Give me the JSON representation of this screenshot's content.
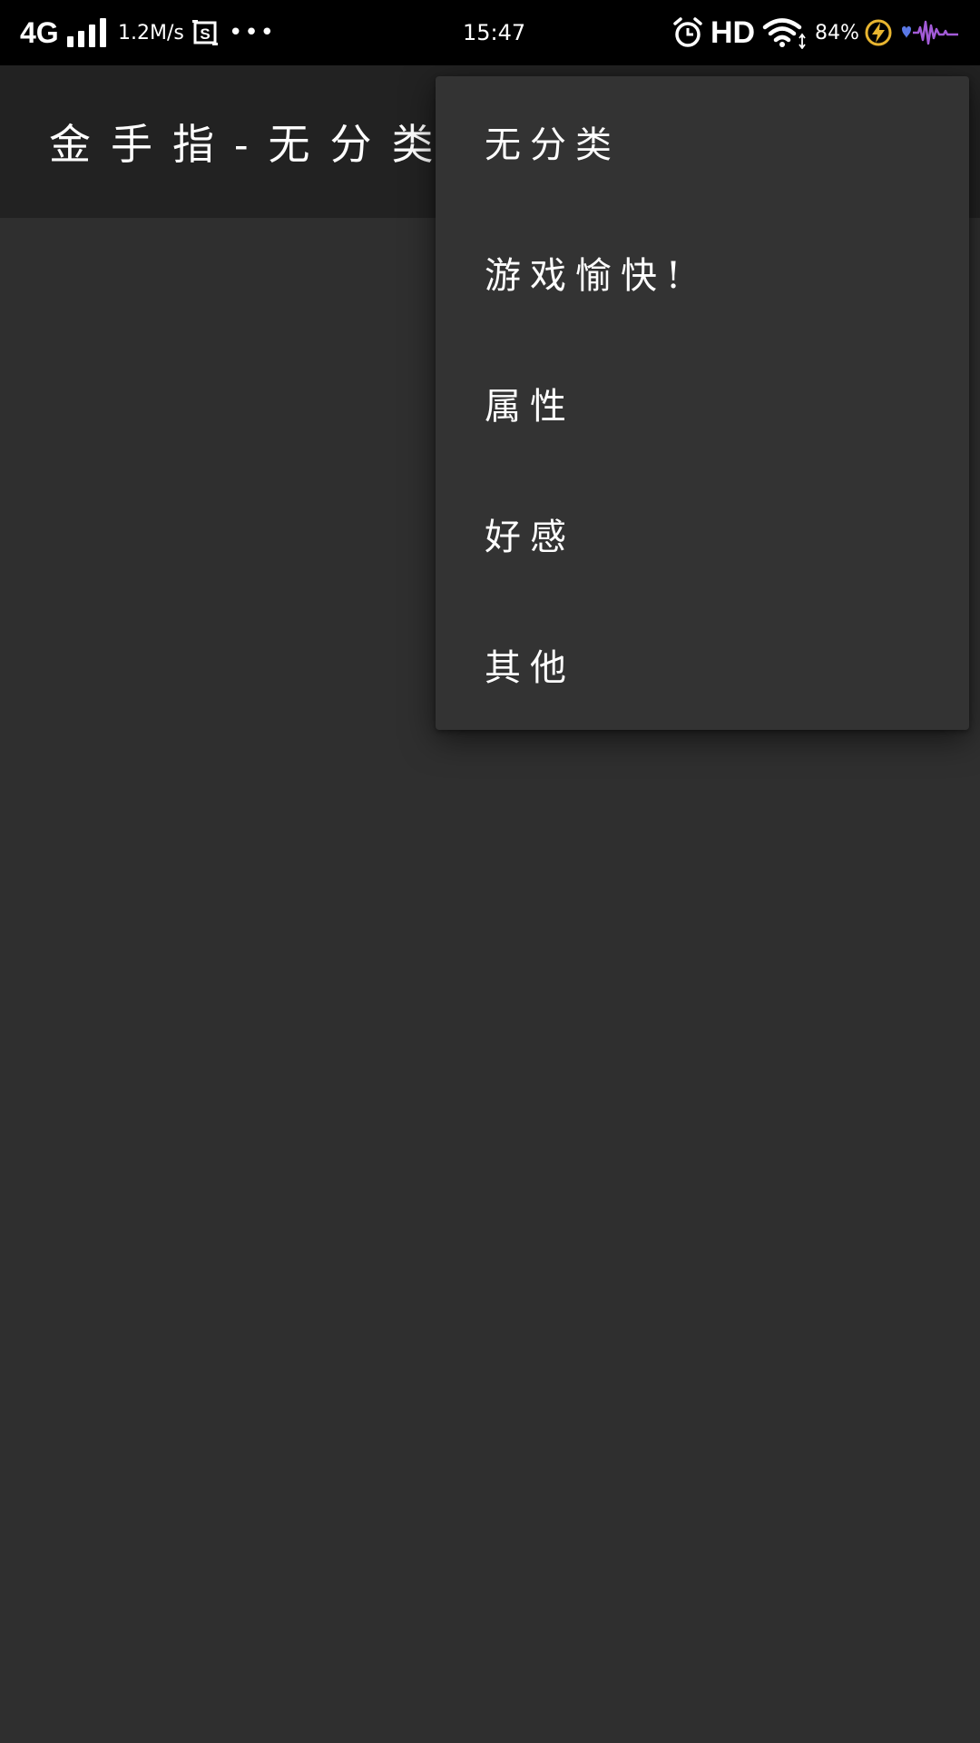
{
  "status_bar": {
    "network": "4G",
    "speed": "1.2M/s",
    "more": "•••",
    "time": "15:47",
    "hd": "HD",
    "battery": "84%",
    "icons": [
      "signal-icon",
      "screenshot-icon",
      "alarm-icon",
      "wifi-icon",
      "charging-icon",
      "heart-icon",
      "audio-wave-icon"
    ],
    "colors": {
      "charging": "#e8b530",
      "heart": "#5a78e6",
      "wave": "#a35bd8"
    }
  },
  "app_bar": {
    "title": "金手指-无分类",
    "background": "#222222"
  },
  "menu": {
    "background": "#333333",
    "items": [
      {
        "label": "无分类"
      },
      {
        "label": "游戏愉快!"
      },
      {
        "label": "属性"
      },
      {
        "label": "好感"
      },
      {
        "label": "其他"
      }
    ]
  },
  "theme": {
    "content_background": "#2f2f2f",
    "text": "#ffffff"
  }
}
